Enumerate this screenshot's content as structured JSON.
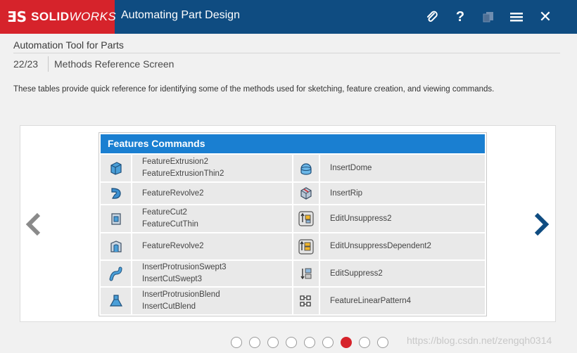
{
  "header": {
    "logo_mark": "ƎS",
    "brand_bold": "SOLID",
    "brand_italic": "WORKS",
    "title": "Automating Part Design",
    "icons": [
      "paperclip-icon",
      "help-icon",
      "pages-icon",
      "menu-icon",
      "close-icon"
    ],
    "help_glyph": "?",
    "close_glyph": "✕"
  },
  "subheader": {
    "title": "Automation Tool for Parts",
    "page": "22/23",
    "page_name": "Methods Reference Screen"
  },
  "intro": "These tables provide quick reference for identifying some of the methods used for sketching, feature creation, and viewing commands.",
  "table": {
    "title": "Features Commands",
    "rows": [
      {
        "left_icon": "extrusion-icon",
        "left": [
          "FeatureExtrusion2",
          "FeatureExtrusionThin2"
        ],
        "right_icon": "dome-icon",
        "right": [
          "InsertDome"
        ]
      },
      {
        "left_icon": "revolve-icon",
        "left": [
          "FeatureRevolve2"
        ],
        "right_icon": "rip-icon",
        "right": [
          "InsertRip"
        ]
      },
      {
        "left_icon": "cut-icon",
        "left": [
          "FeatureCut2",
          "FeatureCutThin"
        ],
        "right_icon": "unsuppress-icon",
        "right": [
          "EditUnsuppress2"
        ]
      },
      {
        "left_icon": "revolve-cut-icon",
        "left": [
          "FeatureRevolve2"
        ],
        "right_icon": "unsuppress-dependent-icon",
        "right": [
          "EditUnsuppressDependent2"
        ]
      },
      {
        "left_icon": "swept-icon",
        "left": [
          "InsertProtrusionSwept3",
          "InsertCutSwept3"
        ],
        "right_icon": "suppress-icon",
        "right": [
          "EditSuppress2"
        ]
      },
      {
        "left_icon": "blend-icon",
        "left": [
          "InsertProtrusionBlend",
          "InsertCutBlend"
        ],
        "right_icon": "linear-pattern-icon",
        "right": [
          "FeatureLinearPattern4"
        ]
      }
    ]
  },
  "pagination": {
    "count": 9,
    "active_index": 6
  },
  "watermark": "https://blog.csdn.net/zengqh0314",
  "colors": {
    "header": "#0f4c81",
    "brand": "#d6232b",
    "table_head": "#1a7fd1",
    "arrow": "#0f4c81",
    "arrow_left": "#8a8a8a"
  }
}
